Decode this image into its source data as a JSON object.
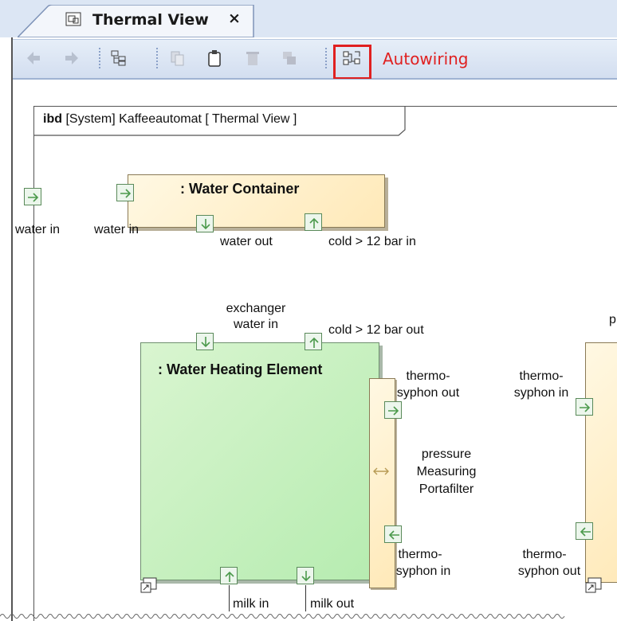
{
  "tab": {
    "title": "Thermal View",
    "close_symbol": "×"
  },
  "toolbar": {
    "items": [
      "back-icon",
      "forward-icon",
      "hierarchy-icon",
      "copy-icon",
      "paste-icon",
      "delete-icon",
      "stack-icon",
      "autowiring-icon"
    ],
    "autowiring_label": "Autowiring"
  },
  "diagram": {
    "frame": {
      "kind": "ibd",
      "rest": "[System] Kaffeeautomat [ Thermal View ]"
    },
    "boundary_port_label": "water in",
    "water_container": {
      "title": ": Water Container",
      "ports": {
        "water_in": "water in",
        "water_out": "water out",
        "cold_in": "cold > 12 bar in"
      }
    },
    "water_heating": {
      "title": ": Water Heating Element",
      "ports": {
        "exchanger_l1": "exchanger",
        "exchanger_l2": "water in",
        "cold_out": "cold > 12 bar out",
        "milk_in": "milk in",
        "milk_out": "milk out"
      }
    },
    "portafilter": {
      "l1": "pressure",
      "l2": "Measuring",
      "l3": "Portafilter",
      "thermo_out_l1": "thermo-",
      "thermo_out_l2": "syphon out",
      "thermo_in_l1": "thermo-",
      "thermo_in_l2": "syphon in"
    },
    "right_part": {
      "partial_label": "p",
      "thermo_in_l1": "thermo-",
      "thermo_in_l2": "syphon in",
      "thermo_out_l1": "thermo-",
      "thermo_out_l2": "syphon out"
    },
    "colors": {
      "accent_red": "#e02020",
      "part_yellow": "#ffe9b8",
      "part_green": "#b6ecb0",
      "port_green": "#4c9a4c"
    }
  }
}
